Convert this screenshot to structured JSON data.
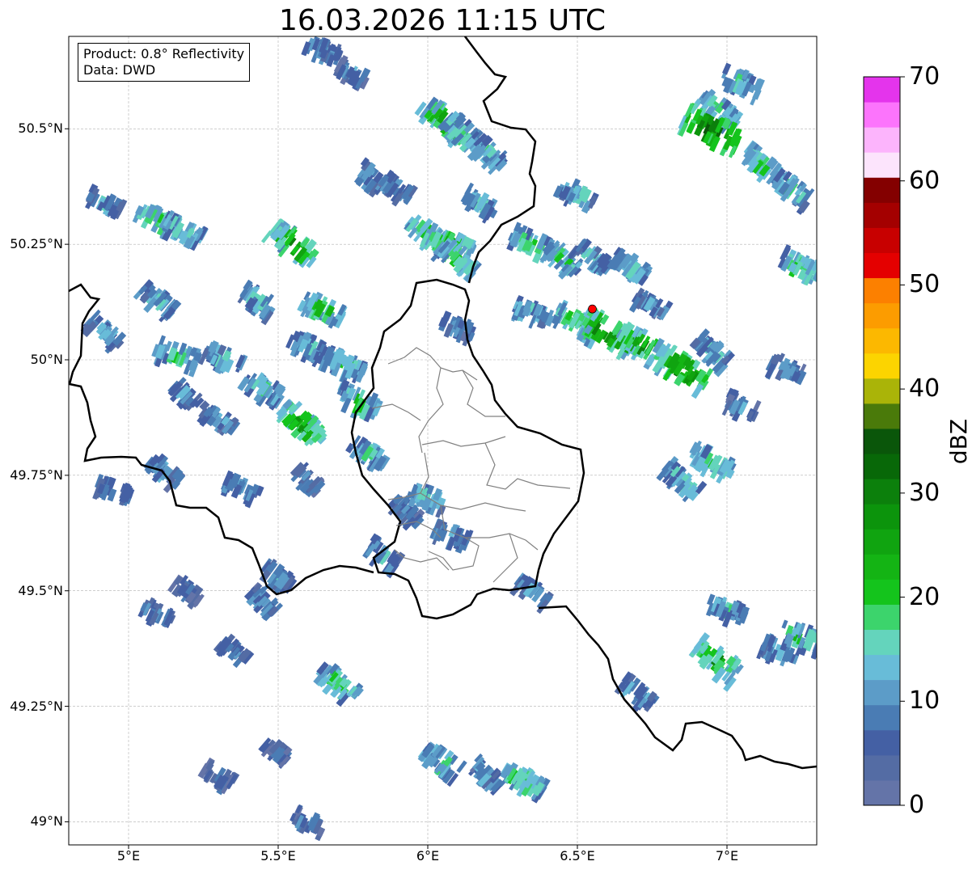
{
  "title": "16.03.2026 11:15 UTC",
  "info": {
    "product": "Product: 0.8° Reflectivity",
    "source": "Data: DWD"
  },
  "map": {
    "lon_range": [
      4.8,
      7.3
    ],
    "lat_range": [
      48.95,
      50.7
    ],
    "lat_ticks": [
      {
        "value": 50.5,
        "label": "50.5°N"
      },
      {
        "value": 50.25,
        "label": "50.25°N"
      },
      {
        "value": 50.0,
        "label": "50°N"
      },
      {
        "value": 49.75,
        "label": "49.75°N"
      },
      {
        "value": 49.5,
        "label": "49.5°N"
      },
      {
        "value": 49.25,
        "label": "49.25°N"
      },
      {
        "value": 49.0,
        "label": "49°N"
      }
    ],
    "lon_ticks": [
      {
        "value": 5.0,
        "label": "5°E"
      },
      {
        "value": 5.5,
        "label": "5.5°E"
      },
      {
        "value": 6.0,
        "label": "6°E"
      },
      {
        "value": 6.5,
        "label": "6.5°E"
      },
      {
        "value": 7.0,
        "label": "7°E"
      }
    ],
    "grid": true,
    "radar_site": {
      "lon": 6.55,
      "lat": 50.11,
      "color": "#ff0000"
    }
  },
  "colorbar": {
    "label": "dBZ",
    "min": 0,
    "max": 70,
    "ticks": [
      {
        "value": 70,
        "label": "70"
      },
      {
        "value": 60,
        "label": "60"
      },
      {
        "value": 50,
        "label": "50"
      },
      {
        "value": 40,
        "label": "40"
      },
      {
        "value": 30,
        "label": "30"
      },
      {
        "value": 20,
        "label": "20"
      },
      {
        "value": 10,
        "label": "10"
      },
      {
        "value": 0,
        "label": "0"
      }
    ],
    "colors": [
      "#6474a8",
      "#546ca4",
      "#4460a4",
      "#4a7cb4",
      "#5c9cc8",
      "#68bcd8",
      "#64d4bc",
      "#3cd46c",
      "#14c41c",
      "#14b414",
      "#10a410",
      "#0c940c",
      "#0c800c",
      "#086808",
      "#0a560a",
      "#4a7a0a",
      "#aab408",
      "#fcd400",
      "#fcb800",
      "#fc9c00",
      "#fc8000",
      "#e40000",
      "#c80000",
      "#a40000",
      "#840000",
      "#fce4fc",
      "#fcb4fc",
      "#fc74fc",
      "#e434ec"
    ]
  },
  "precip_cells": [
    {
      "lon": 6.05,
      "lat": 50.52,
      "dbz": 28
    },
    {
      "lon": 6.12,
      "lat": 50.49,
      "dbz": 22
    },
    {
      "lon": 6.2,
      "lat": 50.45,
      "dbz": 18
    },
    {
      "lon": 5.82,
      "lat": 50.39,
      "dbz": 14
    },
    {
      "lon": 5.9,
      "lat": 50.37,
      "dbz": 12
    },
    {
      "lon": 6.0,
      "lat": 50.27,
      "dbz": 22
    },
    {
      "lon": 6.07,
      "lat": 50.25,
      "dbz": 28
    },
    {
      "lon": 6.1,
      "lat": 50.22,
      "dbz": 20
    },
    {
      "lon": 5.55,
      "lat": 50.25,
      "dbz": 30
    },
    {
      "lon": 5.1,
      "lat": 50.3,
      "dbz": 24
    },
    {
      "lon": 5.18,
      "lat": 50.28,
      "dbz": 20
    },
    {
      "lon": 4.92,
      "lat": 50.34,
      "dbz": 12
    },
    {
      "lon": 5.43,
      "lat": 50.13,
      "dbz": 16
    },
    {
      "lon": 5.65,
      "lat": 50.11,
      "dbz": 22
    },
    {
      "lon": 5.1,
      "lat": 50.13,
      "dbz": 16
    },
    {
      "lon": 5.16,
      "lat": 50.01,
      "dbz": 20
    },
    {
      "lon": 5.32,
      "lat": 50.0,
      "dbz": 18
    },
    {
      "lon": 5.6,
      "lat": 50.03,
      "dbz": 16
    },
    {
      "lon": 5.72,
      "lat": 49.99,
      "dbz": 20
    },
    {
      "lon": 5.45,
      "lat": 49.94,
      "dbz": 18
    },
    {
      "lon": 5.58,
      "lat": 49.86,
      "dbz": 30
    },
    {
      "lon": 5.77,
      "lat": 49.91,
      "dbz": 22
    },
    {
      "lon": 5.3,
      "lat": 49.87,
      "dbz": 12
    },
    {
      "lon": 6.35,
      "lat": 50.25,
      "dbz": 22
    },
    {
      "lon": 6.45,
      "lat": 50.22,
      "dbz": 20
    },
    {
      "lon": 6.55,
      "lat": 50.22,
      "dbz": 16
    },
    {
      "lon": 6.68,
      "lat": 50.2,
      "dbz": 18
    },
    {
      "lon": 6.5,
      "lat": 50.08,
      "dbz": 24
    },
    {
      "lon": 6.6,
      "lat": 50.06,
      "dbz": 35
    },
    {
      "lon": 6.72,
      "lat": 50.03,
      "dbz": 30
    },
    {
      "lon": 6.85,
      "lat": 49.98,
      "dbz": 34
    },
    {
      "lon": 6.95,
      "lat": 50.02,
      "dbz": 16
    },
    {
      "lon": 6.35,
      "lat": 50.1,
      "dbz": 18
    },
    {
      "lon": 6.97,
      "lat": 50.54,
      "dbz": 22
    },
    {
      "lon": 6.95,
      "lat": 50.5,
      "dbz": 38
    },
    {
      "lon": 7.05,
      "lat": 50.6,
      "dbz": 18
    },
    {
      "lon": 7.12,
      "lat": 50.42,
      "dbz": 22
    },
    {
      "lon": 7.22,
      "lat": 50.37,
      "dbz": 18
    },
    {
      "lon": 7.25,
      "lat": 50.2,
      "dbz": 22
    },
    {
      "lon": 6.5,
      "lat": 50.36,
      "dbz": 16
    },
    {
      "lon": 6.18,
      "lat": 50.34,
      "dbz": 14
    },
    {
      "lon": 6.95,
      "lat": 49.78,
      "dbz": 22
    },
    {
      "lon": 6.85,
      "lat": 49.74,
      "dbz": 18
    },
    {
      "lon": 7.0,
      "lat": 49.46,
      "dbz": 16
    },
    {
      "lon": 6.97,
      "lat": 49.35,
      "dbz": 28
    },
    {
      "lon": 7.18,
      "lat": 49.37,
      "dbz": 14
    },
    {
      "lon": 7.25,
      "lat": 49.4,
      "dbz": 22
    },
    {
      "lon": 6.7,
      "lat": 49.28,
      "dbz": 14
    },
    {
      "lon": 6.05,
      "lat": 49.13,
      "dbz": 20
    },
    {
      "lon": 6.2,
      "lat": 49.1,
      "dbz": 14
    },
    {
      "lon": 6.32,
      "lat": 49.09,
      "dbz": 22
    },
    {
      "lon": 5.85,
      "lat": 49.58,
      "dbz": 14
    },
    {
      "lon": 5.93,
      "lat": 49.67,
      "dbz": 12
    },
    {
      "lon": 5.8,
      "lat": 49.8,
      "dbz": 18
    },
    {
      "lon": 6.35,
      "lat": 49.5,
      "dbz": 14
    },
    {
      "lon": 5.35,
      "lat": 49.37,
      "dbz": 10
    },
    {
      "lon": 5.7,
      "lat": 49.3,
      "dbz": 22
    },
    {
      "lon": 5.2,
      "lat": 49.5,
      "dbz": 8
    },
    {
      "lon": 5.45,
      "lat": 49.48,
      "dbz": 12
    },
    {
      "lon": 5.1,
      "lat": 49.45,
      "dbz": 10
    },
    {
      "lon": 4.95,
      "lat": 49.72,
      "dbz": 12
    },
    {
      "lon": 5.12,
      "lat": 49.76,
      "dbz": 14
    },
    {
      "lon": 5.38,
      "lat": 49.72,
      "dbz": 14
    },
    {
      "lon": 5.6,
      "lat": 49.74,
      "dbz": 10
    },
    {
      "lon": 6.0,
      "lat": 49.7,
      "dbz": 18
    },
    {
      "lon": 6.08,
      "lat": 49.62,
      "dbz": 14
    },
    {
      "lon": 5.5,
      "lat": 49.53,
      "dbz": 12
    },
    {
      "lon": 5.2,
      "lat": 49.92,
      "dbz": 12
    },
    {
      "lon": 6.1,
      "lat": 50.07,
      "dbz": 12
    },
    {
      "lon": 7.05,
      "lat": 49.9,
      "dbz": 10
    },
    {
      "lon": 7.2,
      "lat": 49.98,
      "dbz": 12
    },
    {
      "lon": 6.75,
      "lat": 50.12,
      "dbz": 12
    },
    {
      "lon": 4.92,
      "lat": 50.06,
      "dbz": 14
    },
    {
      "lon": 5.5,
      "lat": 49.15,
      "dbz": 8
    },
    {
      "lon": 5.6,
      "lat": 49.0,
      "dbz": 10
    },
    {
      "lon": 5.3,
      "lat": 49.1,
      "dbz": 8
    },
    {
      "lon": 5.65,
      "lat": 50.67,
      "dbz": 12
    },
    {
      "lon": 5.75,
      "lat": 50.62,
      "dbz": 10
    }
  ]
}
